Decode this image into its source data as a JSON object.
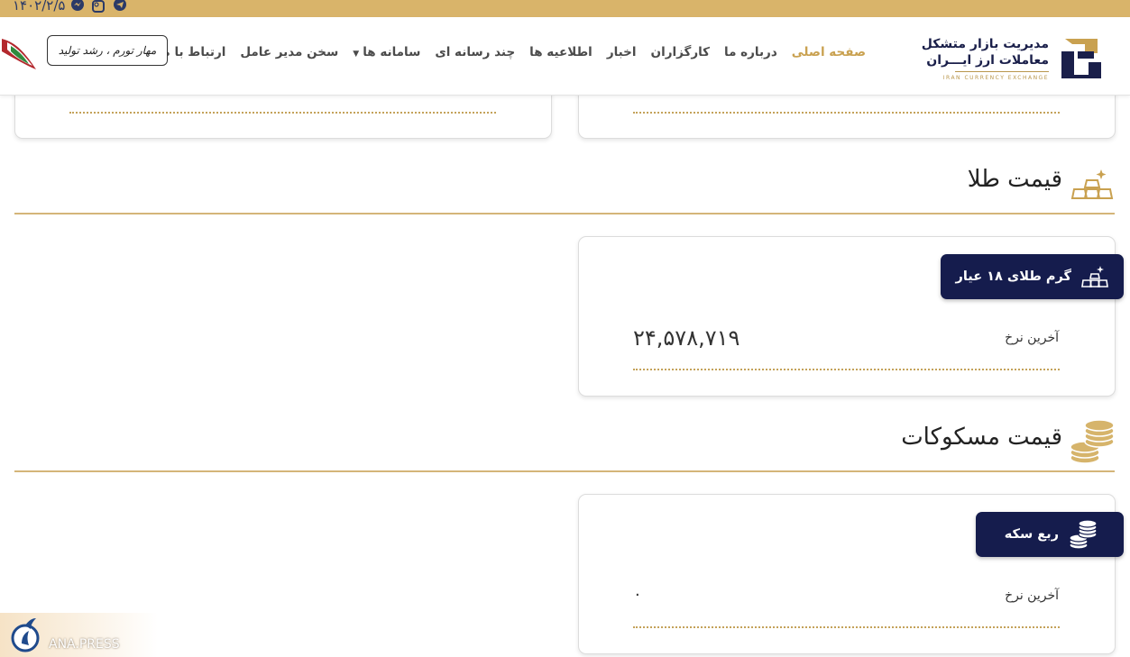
{
  "topbar": {
    "date": "۱۴۰۲/۲/۵",
    "social_icons": [
      "messenger-icon",
      "instagram-icon",
      "telegram-icon"
    ],
    "bg_color": "#d9b46a"
  },
  "header": {
    "logo": {
      "line1": "مدیریت بازار متشکل",
      "line2": "معاملات ارز ایـــران",
      "line3": "IRAN CURRENCY EXCHANGE"
    },
    "menu": [
      {
        "label": "صفحه اصلی",
        "active": true
      },
      {
        "label": "درباره ما"
      },
      {
        "label": "کارگزاران"
      },
      {
        "label": "اخبار"
      },
      {
        "label": "اطلاعیه ها"
      },
      {
        "label": "چند رسانه ای"
      },
      {
        "label": "سامانه ها",
        "has_dropdown": true
      },
      {
        "label": "سخن مدیر عامل"
      },
      {
        "label": "ارتباط با ما"
      }
    ],
    "slogan": "مهار تورم ، رشد تولید"
  },
  "gold_section": {
    "title": "قیمت طلا",
    "card": {
      "badge": "گرم طلای ۱۸ عیار",
      "label": "آخرین نرخ",
      "value": "۲۴,۵۷۸,۷۱۹"
    }
  },
  "coin_section": {
    "title": "قیمت مسکوکات",
    "card": {
      "badge": "ربع سکه",
      "label": "آخرین نرخ",
      "value": "۰"
    }
  },
  "watermark": {
    "text": "ANA.PRESS"
  },
  "colors": {
    "accent_gold": "#c9a150",
    "navy": "#151c4d",
    "divider": "#d4b579"
  }
}
